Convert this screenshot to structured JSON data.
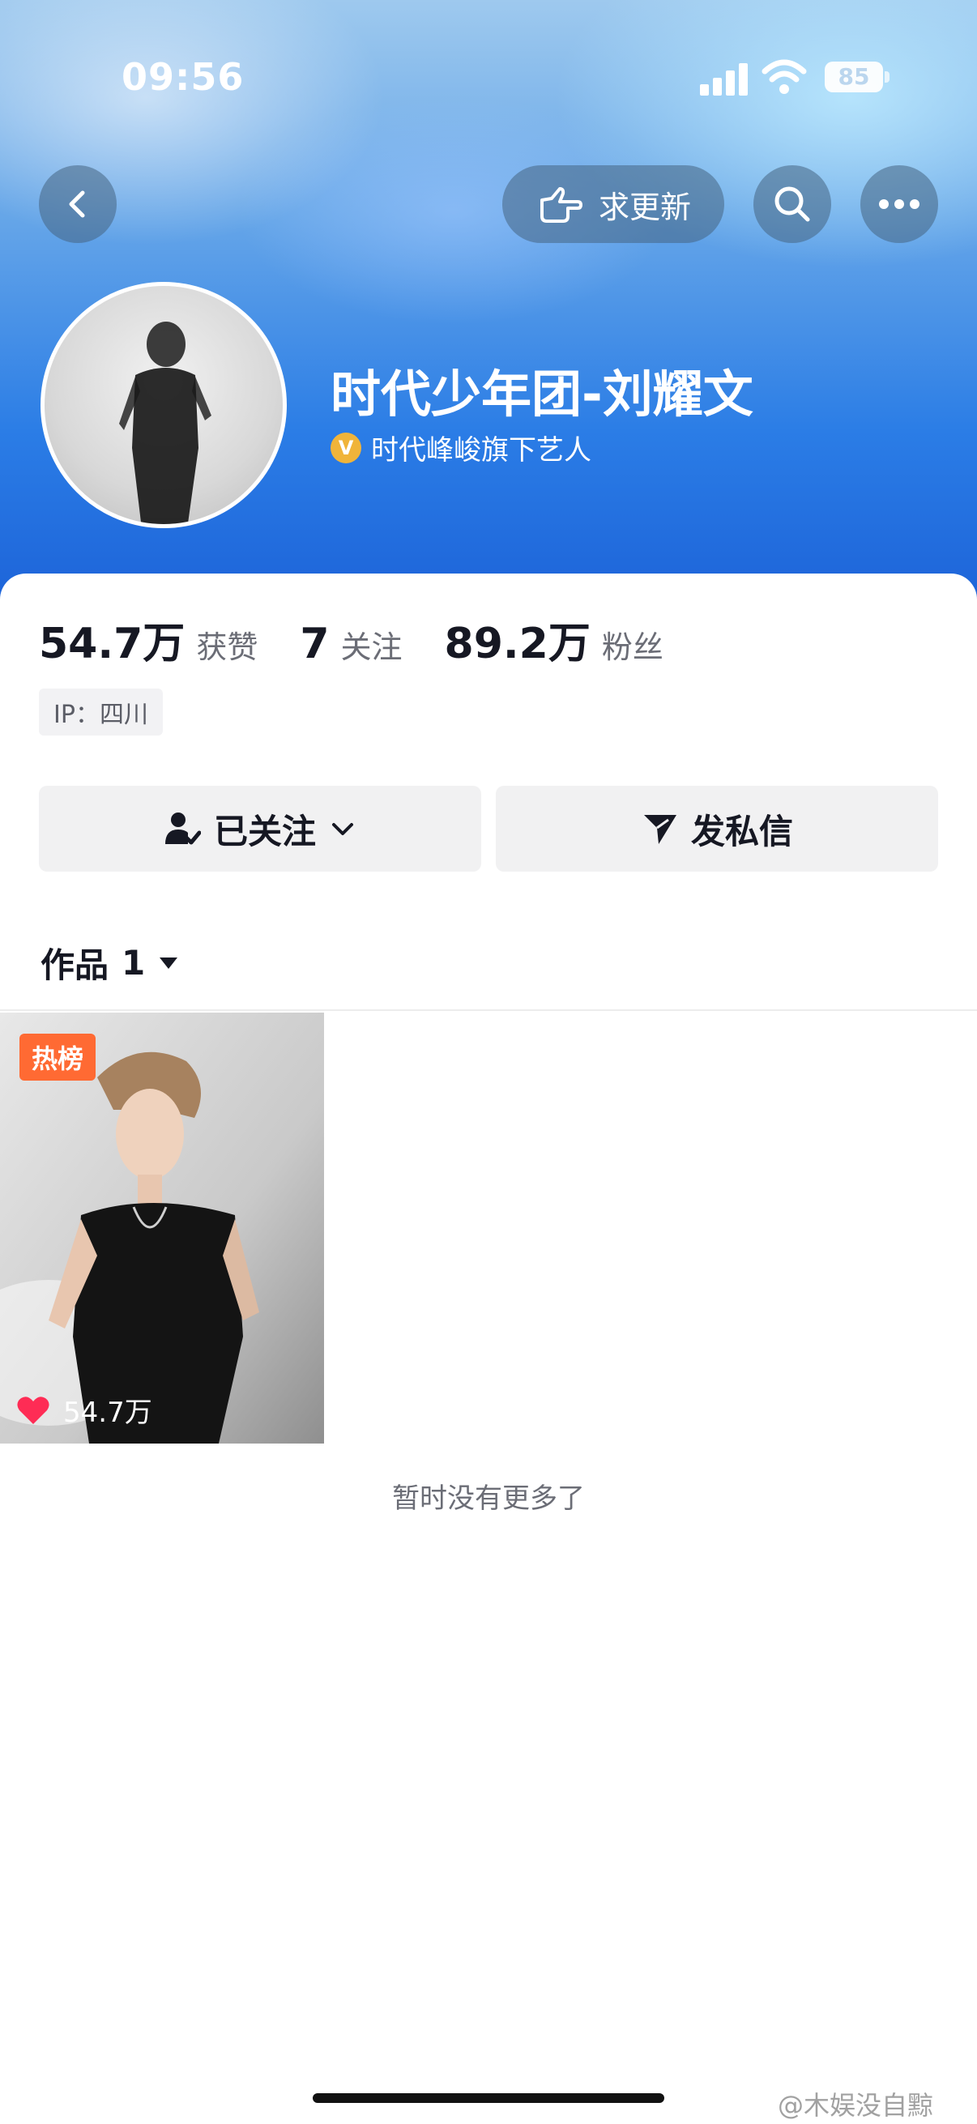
{
  "status_bar": {
    "time": "09:56",
    "battery": "85"
  },
  "header": {
    "request_update_label": "求更新"
  },
  "profile": {
    "name": "时代少年团-刘耀文",
    "verified_text": "时代峰峻旗下艺人",
    "badge_letter": "V"
  },
  "stats": [
    {
      "num": "54.7万",
      "label": "获赞"
    },
    {
      "num": "7",
      "label": "关注"
    },
    {
      "num": "89.2万",
      "label": "粉丝"
    }
  ],
  "ip": "IP：四川",
  "actions": {
    "following_label": "已关注",
    "message_label": "发私信"
  },
  "works_tab": {
    "label": "作品",
    "count": "1"
  },
  "video": {
    "badge": "热榜",
    "likes": "54.7万"
  },
  "footer": {
    "no_more": "暂时没有更多了"
  },
  "watermark": "@木娱没自黥",
  "colors": {
    "accent_hot": "#ff6a33",
    "like_red": "#fe2c55",
    "hero_blue": "#2b7de6"
  }
}
